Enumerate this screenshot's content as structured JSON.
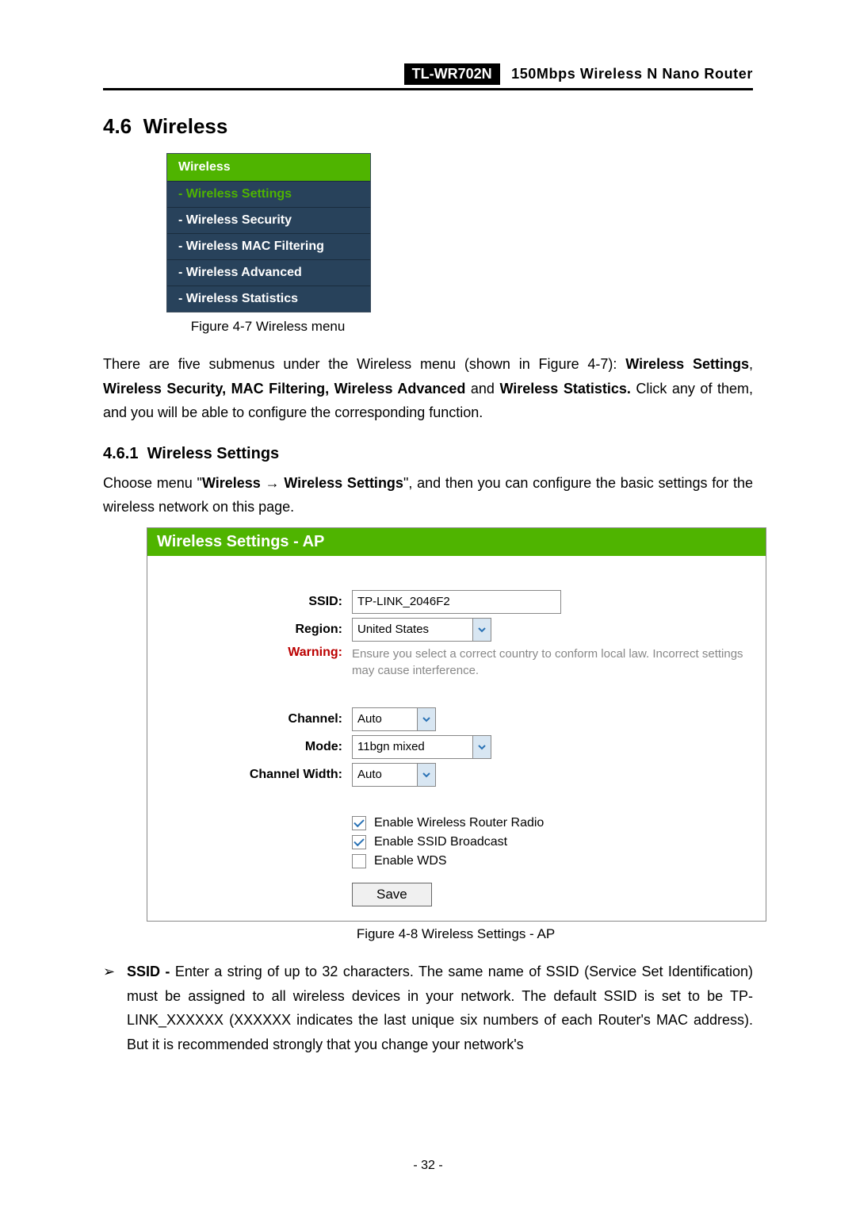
{
  "header": {
    "model": "TL-WR702N",
    "desc": "150Mbps Wireless N Nano Router"
  },
  "section": {
    "number": "4.6",
    "title": "Wireless"
  },
  "menu": {
    "header": "Wireless",
    "items": [
      {
        "label": "- Wireless Settings",
        "active": true
      },
      {
        "label": "- Wireless Security",
        "active": false
      },
      {
        "label": "- Wireless MAC Filtering",
        "active": false
      },
      {
        "label": "- Wireless Advanced",
        "active": false
      },
      {
        "label": "- Wireless Statistics",
        "active": false
      }
    ],
    "caption": "Figure 4-7   Wireless menu"
  },
  "intro": {
    "p1_a": "There are five submenus under the Wireless menu (shown in Figure 4-7): ",
    "p1_b": "Wireless Settings",
    "p1_c": ", ",
    "p1_d": "Wireless Security, MAC Filtering, Wireless Advanced",
    "p1_e": " and ",
    "p1_f": "Wireless Statistics.",
    "p1_g": " Click any of them, and you will be able to configure the corresponding function."
  },
  "subsection": {
    "number": "4.6.1",
    "title": "Wireless Settings",
    "lead_a": "Choose menu \"",
    "lead_b": "Wireless",
    "lead_arrow": " → ",
    "lead_c": "Wireless Settings",
    "lead_d": "\", and then you can configure the basic settings for the wireless network on this page."
  },
  "panel": {
    "title": "Wireless Settings - AP",
    "ssid_label": "SSID:",
    "ssid_value": "TP-LINK_2046F2",
    "region_label": "Region:",
    "region_value": "United States",
    "warning_label": "Warning:",
    "warning_text": "Ensure you select a correct country to conform local law. Incorrect settings may cause interference.",
    "channel_label": "Channel:",
    "channel_value": "Auto",
    "mode_label": "Mode:",
    "mode_value": "11bgn mixed",
    "cw_label": "Channel Width:",
    "cw_value": "Auto",
    "cb1": "Enable Wireless Router Radio",
    "cb2": "Enable SSID Broadcast",
    "cb3": "Enable WDS",
    "save": "Save",
    "caption": "Figure 4-8 Wireless Settings - AP"
  },
  "bullet": {
    "mark": "➢",
    "lead": "SSID - ",
    "text": "Enter a string of up to 32 characters. The same name of SSID (Service Set Identification) must be assigned to all wireless devices in your network. The default SSID is set to be TP-LINK_XXXXXX (XXXXXX indicates the last unique six numbers of each Router's MAC address). But it is recommended strongly that you change your network's"
  },
  "page_number": "- 32 -"
}
